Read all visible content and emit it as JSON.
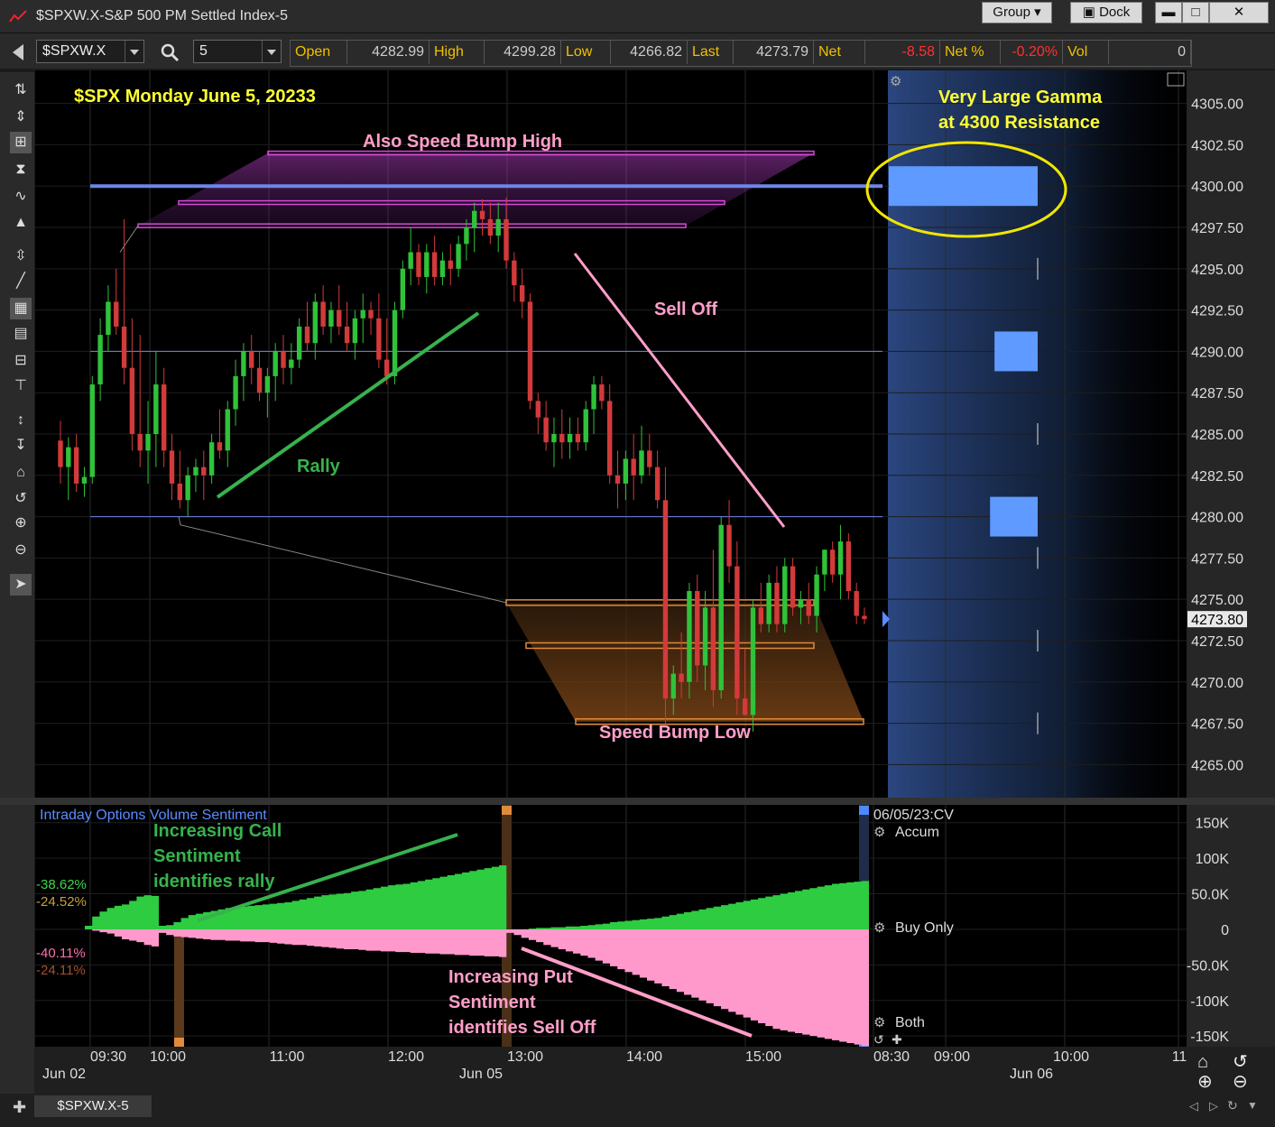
{
  "window": {
    "title": "$SPXW.X-S&P 500 PM Settled Index-5",
    "group_label": "Group",
    "dock_label": "Dock"
  },
  "toolbar": {
    "symbol": "$SPXW.X",
    "interval": "5"
  },
  "quote": [
    {
      "label": "Open",
      "value": "4282.99",
      "neg": false
    },
    {
      "label": "High",
      "value": "4299.28",
      "neg": false
    },
    {
      "label": "Low",
      "value": "4266.82",
      "neg": false
    },
    {
      "label": "Last",
      "value": "4273.79",
      "neg": false
    },
    {
      "label": "Net",
      "value": "-8.58",
      "neg": true
    },
    {
      "label": "Net %",
      "value": "-0.20%",
      "neg": true
    },
    {
      "label": "Vol",
      "value": "0",
      "neg": false
    }
  ],
  "colors": {
    "up": "#2fc23a",
    "down": "#d33a3a",
    "annotation_yellow": "#ffff33",
    "annotation_pink": "#ff9ec9",
    "annotation_green": "#37b24d",
    "gamma_block": "#5e9aff",
    "call_area": "#2ecc40",
    "put_area": "#ff99cc"
  },
  "annotations": {
    "main_title": "$SPX Monday June 5, 20233",
    "gamma_line1": "Very Large Gamma",
    "gamma_line2": "at 4300 Resistance",
    "speed_bump_high": "Also Speed Bump High",
    "sell_off": "Sell Off",
    "rally": "Rally",
    "speed_bump_low": "Speed Bump Low",
    "call_line1": "Increasing Call",
    "call_line2": "Sentiment",
    "call_line3": "identifies rally",
    "put_line1": "Increasing Put",
    "put_line2": "Sentiment",
    "put_line3": "identifies Sell Off"
  },
  "chart_data": [
    {
      "type": "candlestick",
      "title": "",
      "ylim": [
        4263.0,
        4307.0
      ],
      "y_ticks": [
        "4305.00",
        "4302.50",
        "4300.00",
        "4297.50",
        "4295.00",
        "4292.50",
        "4290.00",
        "4287.50",
        "4285.00",
        "4282.50",
        "4280.00",
        "4277.50",
        "4275.00",
        "4272.50",
        "4270.00",
        "4267.50",
        "4265.00"
      ],
      "y_tick_values": [
        4305,
        4302.5,
        4300,
        4297.5,
        4295,
        4292.5,
        4290,
        4287.5,
        4285,
        4282.5,
        4280,
        4277.5,
        4275,
        4272.5,
        4270,
        4267.5,
        4265
      ],
      "last_price_label": "4273.80",
      "last_price": 4273.8,
      "x_tick_labels": [
        "09:30",
        "10:00",
        "11:00",
        "12:00",
        "13:00",
        "14:00",
        "15:00",
        "08:30",
        "09:00",
        "10:00",
        "11"
      ],
      "date_labels": [
        "Jun 02",
        "Jun 05",
        "Jun 06"
      ],
      "horizontal_lines": [
        4300.0,
        4290.0,
        4280.0
      ],
      "gamma_levels": [
        {
          "price": 4300.0,
          "size": 1.0
        },
        {
          "price": 4290.0,
          "size": 0.29
        },
        {
          "price": 4280.0,
          "size": 0.32
        }
      ],
      "candles": [
        [
          4284.6,
          4285.8,
          4282.0,
          4283.0
        ],
        [
          4283.0,
          4284.8,
          4281.0,
          4284.2
        ],
        [
          4284.2,
          4285.0,
          4281.5,
          4282.0
        ],
        [
          4282.0,
          4283.0,
          4281.2,
          4282.4
        ],
        [
          4282.4,
          4288.5,
          4282.0,
          4288.0
        ],
        [
          4288.0,
          4292.0,
          4287.0,
          4291.0
        ],
        [
          4291.0,
          4294.0,
          4290.0,
          4293.0
        ],
        [
          4293.0,
          4295.0,
          4291.0,
          4291.5
        ],
        [
          4291.5,
          4298.0,
          4288.0,
          4289.0
        ],
        [
          4289.0,
          4292.0,
          4284.0,
          4285.0
        ],
        [
          4285.0,
          4291.0,
          4283.0,
          4284.0
        ],
        [
          4284.0,
          4287.0,
          4282.0,
          4285.0
        ],
        [
          4285.0,
          4290.0,
          4283.0,
          4288.0
        ],
        [
          4288.0,
          4289.0,
          4283.0,
          4284.0
        ],
        [
          4284.0,
          4285.0,
          4281.0,
          4282.0
        ],
        [
          4282.0,
          4284.0,
          4280.5,
          4281.0
        ],
        [
          4281.0,
          4283.0,
          4280.0,
          4282.5
        ],
        [
          4282.5,
          4283.5,
          4281.5,
          4283.0
        ],
        [
          4283.0,
          4284.0,
          4281.0,
          4282.5
        ],
        [
          4282.5,
          4285.0,
          4282.0,
          4284.5
        ],
        [
          4284.5,
          4286.5,
          4283.5,
          4284.0
        ],
        [
          4284.0,
          4287.0,
          4283.0,
          4286.5
        ],
        [
          4286.5,
          4289.5,
          4285.5,
          4288.5
        ],
        [
          4288.5,
          4290.5,
          4287.0,
          4290.0
        ],
        [
          4290.0,
          4291.0,
          4288.0,
          4289.0
        ],
        [
          4289.0,
          4290.0,
          4287.0,
          4287.5
        ],
        [
          4287.5,
          4289.0,
          4286.0,
          4288.5
        ],
        [
          4288.5,
          4290.5,
          4287.0,
          4290.0
        ],
        [
          4290.0,
          4291.0,
          4288.0,
          4289.0
        ],
        [
          4289.0,
          4290.5,
          4288.0,
          4289.5
        ],
        [
          4289.5,
          4292.0,
          4289.0,
          4291.5
        ],
        [
          4291.5,
          4293.0,
          4290.0,
          4290.5
        ],
        [
          4290.5,
          4293.5,
          4289.5,
          4293.0
        ],
        [
          4293.0,
          4294.0,
          4291.0,
          4291.5
        ],
        [
          4291.5,
          4293.0,
          4290.5,
          4292.5
        ],
        [
          4292.5,
          4294.0,
          4291.0,
          4291.5
        ],
        [
          4291.5,
          4293.0,
          4290.0,
          4290.5
        ],
        [
          4290.5,
          4292.5,
          4289.5,
          4292.0
        ],
        [
          4292.0,
          4293.5,
          4290.5,
          4292.5
        ],
        [
          4292.5,
          4293.0,
          4291.0,
          4292.0
        ],
        [
          4292.0,
          4293.5,
          4289.0,
          4289.5
        ],
        [
          4289.5,
          4292.0,
          4288.0,
          4288.5
        ],
        [
          4288.5,
          4293.0,
          4288.0,
          4292.5
        ],
        [
          4292.5,
          4295.5,
          4292.0,
          4295.0
        ],
        [
          4295.0,
          4297.5,
          4294.0,
          4296.0
        ],
        [
          4296.0,
          4296.5,
          4294.0,
          4294.5
        ],
        [
          4294.5,
          4296.5,
          4293.5,
          4296.0
        ],
        [
          4296.0,
          4297.0,
          4294.0,
          4294.5
        ],
        [
          4294.5,
          4296.0,
          4294.0,
          4295.5
        ],
        [
          4295.5,
          4296.5,
          4294.0,
          4295.0
        ],
        [
          4295.0,
          4297.0,
          4294.5,
          4296.5
        ],
        [
          4296.5,
          4298.0,
          4295.5,
          4297.5
        ],
        [
          4297.5,
          4299.0,
          4296.0,
          4298.5
        ],
        [
          4298.5,
          4299.2,
          4297.0,
          4298.0
        ],
        [
          4298.0,
          4299.0,
          4296.5,
          4297.0
        ],
        [
          4297.0,
          4299.0,
          4296.0,
          4298.0
        ],
        [
          4298.0,
          4299.3,
          4295.0,
          4295.5
        ],
        [
          4295.5,
          4296.0,
          4293.0,
          4294.0
        ],
        [
          4294.0,
          4295.0,
          4292.0,
          4293.0
        ],
        [
          4293.0,
          4293.5,
          4286.5,
          4287.0
        ],
        [
          4287.0,
          4287.5,
          4285.0,
          4286.0
        ],
        [
          4286.0,
          4287.0,
          4284.0,
          4284.5
        ],
        [
          4284.5,
          4286.0,
          4283.0,
          4285.0
        ],
        [
          4285.0,
          4286.5,
          4283.5,
          4284.5
        ],
        [
          4284.5,
          4286.0,
          4283.5,
          4285.0
        ],
        [
          4285.0,
          4286.0,
          4284.0,
          4284.5
        ],
        [
          4284.5,
          4287.0,
          4284.0,
          4286.5
        ],
        [
          4286.5,
          4288.5,
          4285.0,
          4288.0
        ],
        [
          4288.0,
          4288.5,
          4286.5,
          4287.0
        ],
        [
          4287.0,
          4288.0,
          4282.0,
          4282.5
        ],
        [
          4282.5,
          4284.0,
          4280.5,
          4282.0
        ],
        [
          4282.0,
          4284.0,
          4281.0,
          4283.5
        ],
        [
          4283.5,
          4285.0,
          4281.0,
          4282.5
        ],
        [
          4282.5,
          4285.5,
          4282.0,
          4284.0
        ],
        [
          4284.0,
          4285.0,
          4282.5,
          4283.0
        ],
        [
          4283.0,
          4284.0,
          4280.5,
          4281.0
        ],
        [
          4281.0,
          4283.0,
          4267.5,
          4269.0
        ],
        [
          4269.0,
          4271.0,
          4268.0,
          4270.5
        ],
        [
          4270.5,
          4273.0,
          4269.0,
          4270.0
        ],
        [
          4270.0,
          4276.0,
          4269.0,
          4275.5
        ],
        [
          4275.5,
          4276.5,
          4270.0,
          4271.0
        ],
        [
          4271.0,
          4275.5,
          4269.5,
          4274.5
        ],
        [
          4274.5,
          4278.0,
          4268.5,
          4269.5
        ],
        [
          4269.5,
          4280.0,
          4269.0,
          4279.5
        ],
        [
          4279.5,
          4281.0,
          4276.0,
          4277.0
        ],
        [
          4277.0,
          4278.5,
          4268.0,
          4269.0
        ],
        [
          4269.0,
          4272.0,
          4268.5,
          4268.0
        ],
        [
          4268.0,
          4275.0,
          4267.0,
          4274.5
        ],
        [
          4274.5,
          4276.0,
          4273.0,
          4273.5
        ],
        [
          4273.5,
          4276.5,
          4273.0,
          4276.0
        ],
        [
          4276.0,
          4277.0,
          4273.0,
          4273.5
        ],
        [
          4273.5,
          4277.5,
          4273.0,
          4277.0
        ],
        [
          4277.0,
          4277.5,
          4274.0,
          4274.5
        ],
        [
          4274.5,
          4275.5,
          4273.5,
          4275.0
        ],
        [
          4275.0,
          4276.0,
          4273.5,
          4274.0
        ],
        [
          4274.0,
          4277.0,
          4273.0,
          4276.5
        ],
        [
          4276.5,
          4278.0,
          4275.5,
          4278.0
        ],
        [
          4278.0,
          4278.5,
          4276.0,
          4276.5
        ],
        [
          4276.5,
          4279.5,
          4275.0,
          4278.5
        ],
        [
          4278.5,
          4279.0,
          4275.0,
          4275.5
        ],
        [
          4275.5,
          4276.0,
          4273.5,
          4274.0
        ],
        [
          4274.0,
          4274.5,
          4273.5,
          4273.8
        ]
      ]
    },
    {
      "type": "area",
      "title": "Intraday Options Volume Sentiment",
      "ylim": [
        -165000,
        175000
      ],
      "y_ticks": [
        "150K",
        "100K",
        "50.0K",
        "0",
        "-50.0K",
        "-100K",
        "-150K"
      ],
      "y_tick_values": [
        150000,
        100000,
        50000,
        0,
        -50000,
        -100000,
        -150000
      ],
      "date_stamp": "06/05/23:CV",
      "mode_labels": [
        "Accum",
        "Buy Only",
        "Both"
      ],
      "pct_labels": [
        "-38.62%",
        "-24.52%",
        "-40.11%",
        "-24.11%"
      ],
      "series": [
        {
          "name": "Calls",
          "values": [
            5,
            18,
            25,
            30,
            33,
            35,
            40,
            46,
            48,
            47,
            5,
            6,
            10,
            16,
            20,
            22,
            24,
            26,
            28,
            30,
            31,
            32,
            33,
            34,
            35,
            36,
            37,
            38,
            40,
            42,
            44,
            46,
            48,
            49,
            50,
            51,
            53,
            54,
            56,
            58,
            60,
            62,
            63,
            64,
            66,
            68,
            70,
            72,
            74,
            76,
            78,
            80,
            82,
            84,
            86,
            88,
            90,
            -2,
            -1,
            0,
            1,
            2,
            2,
            3,
            3,
            4,
            4,
            5,
            6,
            7,
            8,
            10,
            11,
            12,
            13,
            14,
            15,
            16,
            18,
            20,
            22,
            24,
            26,
            28,
            30,
            32,
            34,
            36,
            38,
            40,
            42,
            44,
            46,
            48,
            50,
            52,
            54,
            56,
            58,
            60,
            62,
            64,
            65,
            66,
            67,
            68
          ]
        },
        {
          "name": "Puts",
          "values": [
            0,
            -2,
            -4,
            -6,
            -10,
            -14,
            -16,
            -18,
            -22,
            -24,
            -5,
            -8,
            -10,
            -11,
            -12,
            -13,
            -14,
            -15,
            -15,
            -16,
            -16,
            -17,
            -17,
            -18,
            -18,
            -19,
            -20,
            -21,
            -22,
            -22,
            -23,
            -24,
            -25,
            -26,
            -27,
            -28,
            -28,
            -29,
            -30,
            -30,
            -31,
            -31,
            -32,
            -32,
            -33,
            -33,
            -34,
            -34,
            -35,
            -35,
            -36,
            -36,
            -37,
            -37,
            -38,
            -38,
            -39,
            -5,
            -8,
            -12,
            -15,
            -18,
            -22,
            -25,
            -28,
            -31,
            -34,
            -37,
            -40,
            -44,
            -48,
            -52,
            -56,
            -60,
            -64,
            -68,
            -72,
            -76,
            -80,
            -84,
            -88,
            -92,
            -96,
            -100,
            -104,
            -108,
            -112,
            -116,
            -120,
            -124,
            -128,
            -132,
            -136,
            -140,
            -142,
            -144,
            -146,
            -148,
            -150,
            -152,
            -154,
            -156,
            -158,
            -160,
            -162,
            -164
          ]
        }
      ]
    }
  ],
  "bottom": {
    "tab_label": "$SPXW.X-5"
  }
}
